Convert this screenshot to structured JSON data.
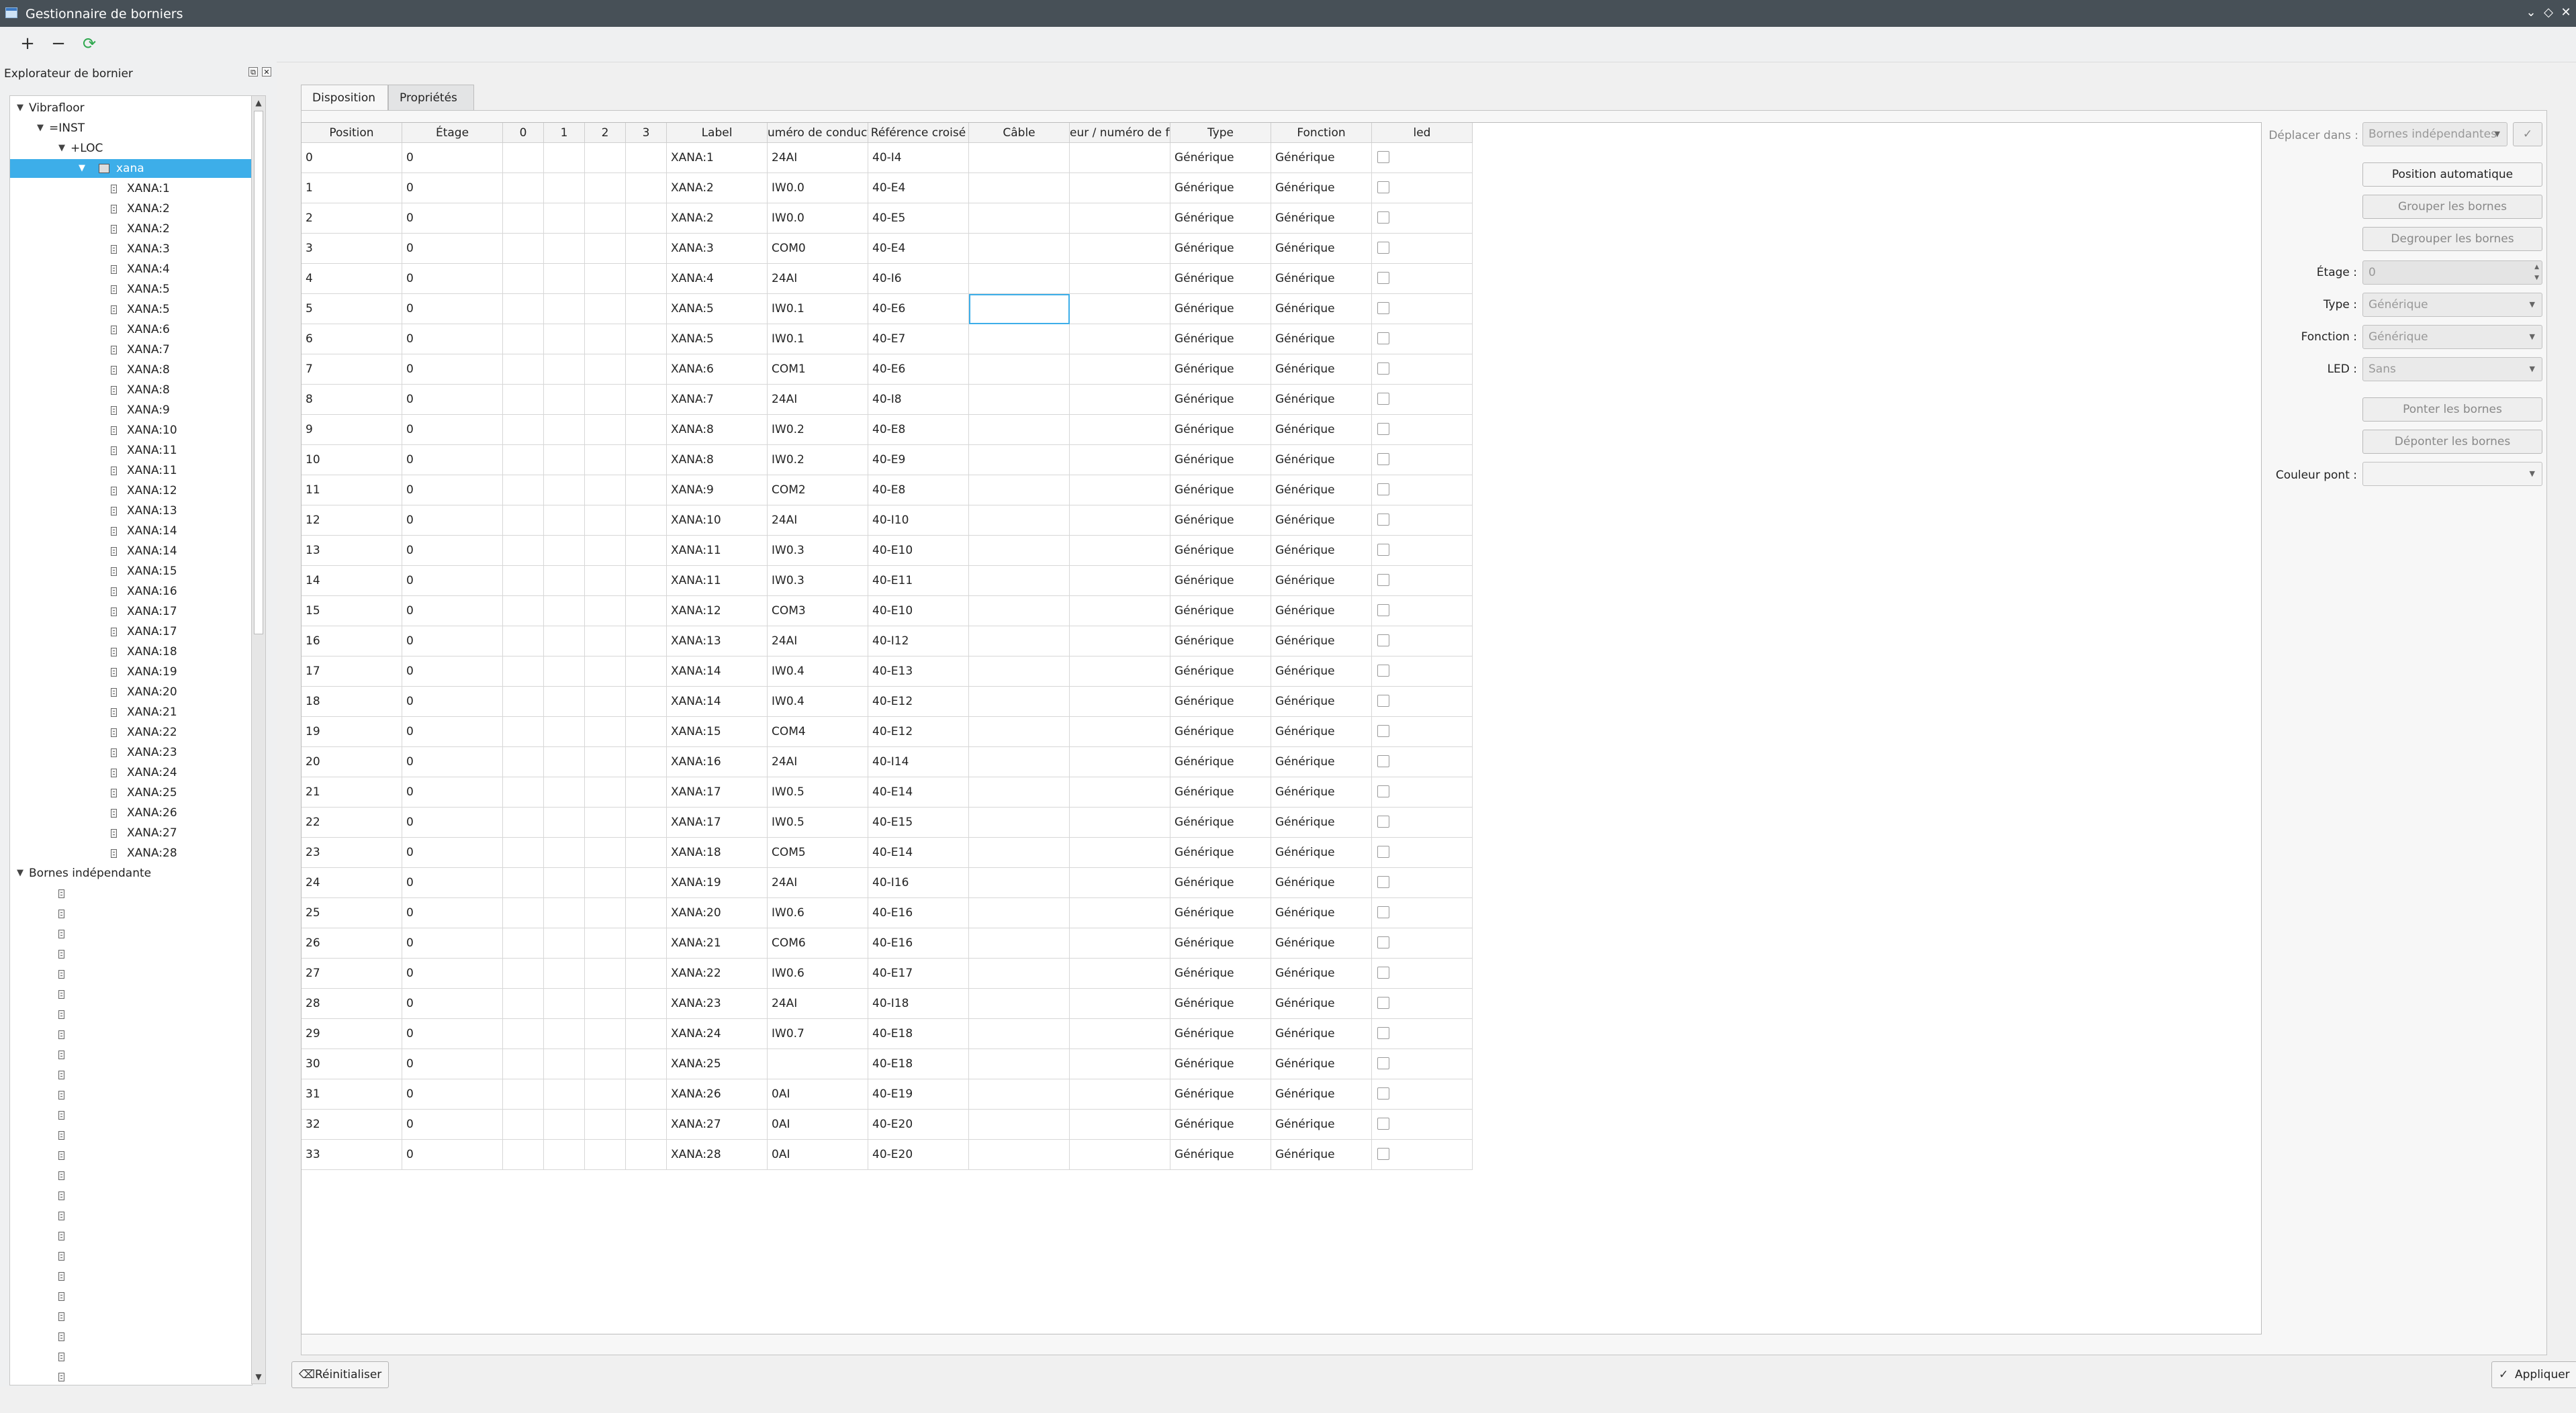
{
  "window": {
    "title": "Gestionnaire de borniers"
  },
  "toolbar": {
    "add": "+",
    "remove": "−",
    "refresh": "⟳"
  },
  "sidebar": {
    "title": "Explorateur de bornier",
    "tree": [
      {
        "label": "Vibrafloor",
        "level": 0,
        "expanded": true,
        "icon": "none"
      },
      {
        "label": "=INST",
        "level": 1,
        "expanded": true,
        "icon": "none"
      },
      {
        "label": "+LOC",
        "level": 2,
        "expanded": true,
        "icon": "none"
      },
      {
        "label": "xana",
        "level": 3,
        "expanded": true,
        "icon": "group",
        "selected": true
      },
      {
        "label": "XANA:1",
        "level": 4,
        "icon": "terminal"
      },
      {
        "label": "XANA:2",
        "level": 4,
        "icon": "terminal"
      },
      {
        "label": "XANA:2",
        "level": 4,
        "icon": "terminal"
      },
      {
        "label": "XANA:3",
        "level": 4,
        "icon": "terminal"
      },
      {
        "label": "XANA:4",
        "level": 4,
        "icon": "terminal"
      },
      {
        "label": "XANA:5",
        "level": 4,
        "icon": "terminal"
      },
      {
        "label": "XANA:5",
        "level": 4,
        "icon": "terminal"
      },
      {
        "label": "XANA:6",
        "level": 4,
        "icon": "terminal"
      },
      {
        "label": "XANA:7",
        "level": 4,
        "icon": "terminal"
      },
      {
        "label": "XANA:8",
        "level": 4,
        "icon": "terminal"
      },
      {
        "label": "XANA:8",
        "level": 4,
        "icon": "terminal"
      },
      {
        "label": "XANA:9",
        "level": 4,
        "icon": "terminal"
      },
      {
        "label": "XANA:10",
        "level": 4,
        "icon": "terminal"
      },
      {
        "label": "XANA:11",
        "level": 4,
        "icon": "terminal"
      },
      {
        "label": "XANA:11",
        "level": 4,
        "icon": "terminal"
      },
      {
        "label": "XANA:12",
        "level": 4,
        "icon": "terminal"
      },
      {
        "label": "XANA:13",
        "level": 4,
        "icon": "terminal"
      },
      {
        "label": "XANA:14",
        "level": 4,
        "icon": "terminal"
      },
      {
        "label": "XANA:14",
        "level": 4,
        "icon": "terminal"
      },
      {
        "label": "XANA:15",
        "level": 4,
        "icon": "terminal"
      },
      {
        "label": "XANA:16",
        "level": 4,
        "icon": "terminal"
      },
      {
        "label": "XANA:17",
        "level": 4,
        "icon": "terminal"
      },
      {
        "label": "XANA:17",
        "level": 4,
        "icon": "terminal"
      },
      {
        "label": "XANA:18",
        "level": 4,
        "icon": "terminal"
      },
      {
        "label": "XANA:19",
        "level": 4,
        "icon": "terminal"
      },
      {
        "label": "XANA:20",
        "level": 4,
        "icon": "terminal"
      },
      {
        "label": "XANA:21",
        "level": 4,
        "icon": "terminal"
      },
      {
        "label": "XANA:22",
        "level": 4,
        "icon": "terminal"
      },
      {
        "label": "XANA:23",
        "level": 4,
        "icon": "terminal"
      },
      {
        "label": "XANA:24",
        "level": 4,
        "icon": "terminal"
      },
      {
        "label": "XANA:25",
        "level": 4,
        "icon": "terminal"
      },
      {
        "label": "XANA:26",
        "level": 4,
        "icon": "terminal"
      },
      {
        "label": "XANA:27",
        "level": 4,
        "icon": "terminal"
      },
      {
        "label": "XANA:28",
        "level": 4,
        "icon": "terminal"
      },
      {
        "label": "Bornes indépendante",
        "level": 0,
        "expanded": true,
        "icon": "none"
      },
      {
        "label": "",
        "level": 2,
        "icon": "terminal"
      },
      {
        "label": "",
        "level": 2,
        "icon": "terminal"
      },
      {
        "label": "",
        "level": 2,
        "icon": "terminal"
      },
      {
        "label": "",
        "level": 2,
        "icon": "terminal"
      },
      {
        "label": "",
        "level": 2,
        "icon": "terminal"
      },
      {
        "label": "",
        "level": 2,
        "icon": "terminal"
      },
      {
        "label": "",
        "level": 2,
        "icon": "terminal"
      },
      {
        "label": "",
        "level": 2,
        "icon": "terminal"
      },
      {
        "label": "",
        "level": 2,
        "icon": "terminal"
      },
      {
        "label": "",
        "level": 2,
        "icon": "terminal"
      },
      {
        "label": "",
        "level": 2,
        "icon": "terminal"
      },
      {
        "label": "",
        "level": 2,
        "icon": "terminal"
      },
      {
        "label": "",
        "level": 2,
        "icon": "terminal"
      },
      {
        "label": "",
        "level": 2,
        "icon": "terminal"
      },
      {
        "label": "",
        "level": 2,
        "icon": "terminal"
      },
      {
        "label": "",
        "level": 2,
        "icon": "terminal"
      },
      {
        "label": "",
        "level": 2,
        "icon": "terminal"
      },
      {
        "label": "",
        "level": 2,
        "icon": "terminal"
      },
      {
        "label": "",
        "level": 2,
        "icon": "terminal"
      },
      {
        "label": "",
        "level": 2,
        "icon": "terminal"
      },
      {
        "label": "",
        "level": 2,
        "icon": "terminal"
      },
      {
        "label": "",
        "level": 2,
        "icon": "terminal"
      },
      {
        "label": "",
        "level": 2,
        "icon": "terminal"
      },
      {
        "label": "",
        "level": 2,
        "icon": "terminal"
      },
      {
        "label": "",
        "level": 2,
        "icon": "terminal"
      },
      {
        "label": "",
        "level": 2,
        "icon": "terminal"
      },
      {
        "label": "",
        "level": 2,
        "icon": "terminal"
      },
      {
        "label": "",
        "level": 2,
        "icon": "terminal"
      },
      {
        "label": "",
        "level": 2,
        "icon": "terminal"
      }
    ]
  },
  "tabs": [
    {
      "label": "Disposition",
      "active": true
    },
    {
      "label": "Propriétés",
      "active": false
    }
  ],
  "table": {
    "headers": [
      "Position",
      "Étage",
      "0",
      "1",
      "2",
      "3",
      "Label",
      "uméro de conducte",
      "Référence croisé",
      "Câble",
      "eur / numéro de fil c",
      "Type",
      "Fonction",
      "led"
    ],
    "rows": [
      [
        "0",
        "0",
        "",
        "",
        "",
        "",
        "XANA:1",
        "24AI",
        "40-I4",
        "",
        "",
        "Générique",
        "Générique",
        false
      ],
      [
        "1",
        "0",
        "",
        "",
        "",
        "",
        "XANA:2",
        "IW0.0",
        "40-E4",
        "",
        "",
        "Générique",
        "Générique",
        false
      ],
      [
        "2",
        "0",
        "",
        "",
        "",
        "",
        "XANA:2",
        "IW0.0",
        "40-E5",
        "",
        "",
        "Générique",
        "Générique",
        false
      ],
      [
        "3",
        "0",
        "",
        "",
        "",
        "",
        "XANA:3",
        "COM0",
        "40-E4",
        "",
        "",
        "Générique",
        "Générique",
        false
      ],
      [
        "4",
        "0",
        "",
        "",
        "",
        "",
        "XANA:4",
        "24AI",
        "40-I6",
        "",
        "",
        "Générique",
        "Générique",
        false
      ],
      [
        "5",
        "0",
        "",
        "",
        "",
        "",
        "XANA:5",
        "IW0.1",
        "40-E6",
        "",
        "",
        "Générique",
        "Générique",
        false
      ],
      [
        "6",
        "0",
        "",
        "",
        "",
        "",
        "XANA:5",
        "IW0.1",
        "40-E7",
        "",
        "",
        "Générique",
        "Générique",
        false
      ],
      [
        "7",
        "0",
        "",
        "",
        "",
        "",
        "XANA:6",
        "COM1",
        "40-E6",
        "",
        "",
        "Générique",
        "Générique",
        false
      ],
      [
        "8",
        "0",
        "",
        "",
        "",
        "",
        "XANA:7",
        "24AI",
        "40-I8",
        "",
        "",
        "Générique",
        "Générique",
        false
      ],
      [
        "9",
        "0",
        "",
        "",
        "",
        "",
        "XANA:8",
        "IW0.2",
        "40-E8",
        "",
        "",
        "Générique",
        "Générique",
        false
      ],
      [
        "10",
        "0",
        "",
        "",
        "",
        "",
        "XANA:8",
        "IW0.2",
        "40-E9",
        "",
        "",
        "Générique",
        "Générique",
        false
      ],
      [
        "11",
        "0",
        "",
        "",
        "",
        "",
        "XANA:9",
        "COM2",
        "40-E8",
        "",
        "",
        "Générique",
        "Générique",
        false
      ],
      [
        "12",
        "0",
        "",
        "",
        "",
        "",
        "XANA:10",
        "24AI",
        "40-I10",
        "",
        "",
        "Générique",
        "Générique",
        false
      ],
      [
        "13",
        "0",
        "",
        "",
        "",
        "",
        "XANA:11",
        "IW0.3",
        "40-E10",
        "",
        "",
        "Générique",
        "Générique",
        false
      ],
      [
        "14",
        "0",
        "",
        "",
        "",
        "",
        "XANA:11",
        "IW0.3",
        "40-E11",
        "",
        "",
        "Générique",
        "Générique",
        false
      ],
      [
        "15",
        "0",
        "",
        "",
        "",
        "",
        "XANA:12",
        "COM3",
        "40-E10",
        "",
        "",
        "Générique",
        "Générique",
        false
      ],
      [
        "16",
        "0",
        "",
        "",
        "",
        "",
        "XANA:13",
        "24AI",
        "40-I12",
        "",
        "",
        "Générique",
        "Générique",
        false
      ],
      [
        "17",
        "0",
        "",
        "",
        "",
        "",
        "XANA:14",
        "IW0.4",
        "40-E13",
        "",
        "",
        "Générique",
        "Générique",
        false
      ],
      [
        "18",
        "0",
        "",
        "",
        "",
        "",
        "XANA:14",
        "IW0.4",
        "40-E12",
        "",
        "",
        "Générique",
        "Générique",
        false
      ],
      [
        "19",
        "0",
        "",
        "",
        "",
        "",
        "XANA:15",
        "COM4",
        "40-E12",
        "",
        "",
        "Générique",
        "Générique",
        false
      ],
      [
        "20",
        "0",
        "",
        "",
        "",
        "",
        "XANA:16",
        "24AI",
        "40-I14",
        "",
        "",
        "Générique",
        "Générique",
        false
      ],
      [
        "21",
        "0",
        "",
        "",
        "",
        "",
        "XANA:17",
        "IW0.5",
        "40-E14",
        "",
        "",
        "Générique",
        "Générique",
        false
      ],
      [
        "22",
        "0",
        "",
        "",
        "",
        "",
        "XANA:17",
        "IW0.5",
        "40-E15",
        "",
        "",
        "Générique",
        "Générique",
        false
      ],
      [
        "23",
        "0",
        "",
        "",
        "",
        "",
        "XANA:18",
        "COM5",
        "40-E14",
        "",
        "",
        "Générique",
        "Générique",
        false
      ],
      [
        "24",
        "0",
        "",
        "",
        "",
        "",
        "XANA:19",
        "24AI",
        "40-I16",
        "",
        "",
        "Générique",
        "Générique",
        false
      ],
      [
        "25",
        "0",
        "",
        "",
        "",
        "",
        "XANA:20",
        "IW0.6",
        "40-E16",
        "",
        "",
        "Générique",
        "Générique",
        false
      ],
      [
        "26",
        "0",
        "",
        "",
        "",
        "",
        "XANA:21",
        "COM6",
        "40-E16",
        "",
        "",
        "Générique",
        "Générique",
        false
      ],
      [
        "27",
        "0",
        "",
        "",
        "",
        "",
        "XANA:22",
        "IW0.6",
        "40-E17",
        "",
        "",
        "Générique",
        "Générique",
        false
      ],
      [
        "28",
        "0",
        "",
        "",
        "",
        "",
        "XANA:23",
        "24AI",
        "40-I18",
        "",
        "",
        "Générique",
        "Générique",
        false
      ],
      [
        "29",
        "0",
        "",
        "",
        "",
        "",
        "XANA:24",
        "IW0.7",
        "40-E18",
        "",
        "",
        "Générique",
        "Générique",
        false
      ],
      [
        "30",
        "0",
        "",
        "",
        "",
        "",
        "XANA:25",
        "",
        "40-E18",
        "",
        "",
        "Générique",
        "Générique",
        false
      ],
      [
        "31",
        "0",
        "",
        "",
        "",
        "",
        "XANA:26",
        "0AI",
        "40-E19",
        "",
        "",
        "Générique",
        "Générique",
        false
      ],
      [
        "32",
        "0",
        "",
        "",
        "",
        "",
        "XANA:27",
        "0AI",
        "40-E20",
        "",
        "",
        "Générique",
        "Générique",
        false
      ],
      [
        "33",
        "0",
        "",
        "",
        "",
        "",
        "XANA:28",
        "0AI",
        "40-E20",
        "",
        "",
        "Générique",
        "Générique",
        false
      ]
    ]
  },
  "right_panel": {
    "move_label": "Déplacer dans :",
    "move_value": "Bornes indépendantes",
    "auto_position": "Position automatique",
    "group": "Grouper les bornes",
    "ungroup": "Degrouper les bornes",
    "floor_label": "Étage :",
    "floor_value": "0",
    "type_label": "Type :",
    "type_value": "Générique",
    "function_label": "Fonction :",
    "function_value": "Générique",
    "led_label": "LED :",
    "led_value": "Sans",
    "bridge": "Ponter les bornes",
    "unbridge": "Déponter les bornes",
    "bridge_color_label": "Couleur pont :",
    "bridge_color_value": ""
  },
  "footer": {
    "reset": "Réinitialiser",
    "apply": "Appliquer"
  }
}
